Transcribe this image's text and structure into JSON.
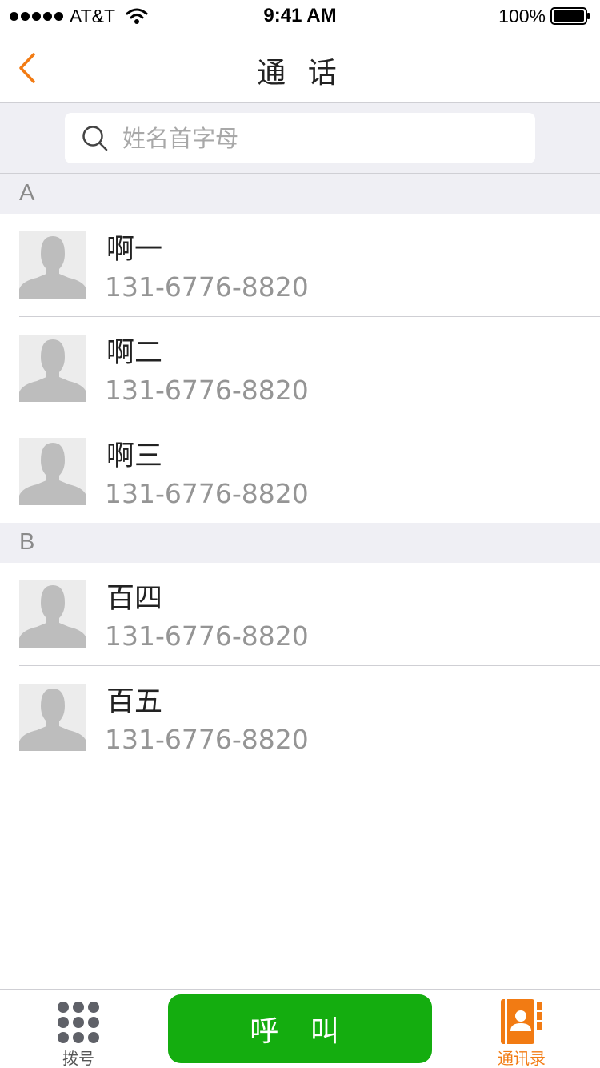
{
  "status_bar": {
    "carrier": "AT&T",
    "time": "9:41 AM",
    "battery": "100%",
    "icons": [
      "signal-dots-icon",
      "wifi-icon",
      "battery-icon"
    ]
  },
  "nav": {
    "title": "通 话",
    "back_icon": "chevron-left-icon"
  },
  "search": {
    "placeholder": "姓名首字母",
    "value": "",
    "icon": "search-icon"
  },
  "sections": [
    {
      "letter": "A",
      "contacts": [
        {
          "name": "啊一",
          "phone": "131-6776-8820"
        },
        {
          "name": "啊二",
          "phone": "131-6776-8820"
        },
        {
          "name": "啊三",
          "phone": "131-6776-8820"
        }
      ]
    },
    {
      "letter": "B",
      "contacts": [
        {
          "name": "百四",
          "phone": "131-6776-8820"
        },
        {
          "name": "百五",
          "phone": "131-6776-8820"
        }
      ]
    }
  ],
  "tab_bar": {
    "dial_label": "拨号",
    "call_label": "呼 叫",
    "contacts_label": "通讯录",
    "dial_icon": "keypad-icon",
    "contacts_icon": "contacts-book-icon"
  },
  "colors": {
    "accent": "#f27b13",
    "call_green": "#14ad0f",
    "section_bg": "#efeff4",
    "secondary_text": "#959595"
  }
}
